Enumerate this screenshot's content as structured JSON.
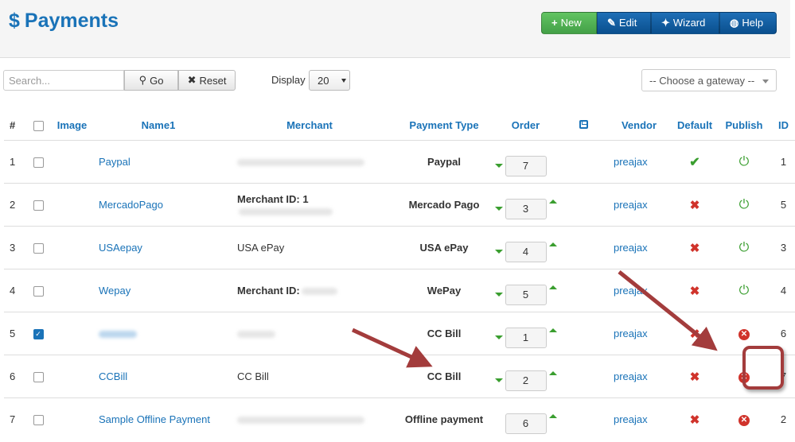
{
  "header": {
    "title": "Payments",
    "toolbar": {
      "new_label": "New",
      "edit_label": "Edit",
      "wizard_label": "Wizard",
      "help_label": "Help"
    }
  },
  "filters": {
    "search_placeholder": "Search...",
    "search_value": "",
    "go_label": "Go",
    "reset_label": "Reset",
    "display_label": "Display",
    "display_value": "20",
    "gateway_value": "-- Choose a gateway --"
  },
  "table": {
    "columns": [
      "#",
      "Image",
      "Name1",
      "Merchant",
      "Payment Type",
      "Order",
      "Vendor",
      "Default",
      "Publish",
      "ID"
    ],
    "rows": [
      {
        "num": "1",
        "name": "Paypal",
        "merchant": "",
        "payment_type": "Paypal",
        "order": "7",
        "vendor": "preajax",
        "id": "1"
      },
      {
        "num": "2",
        "name": "MercadoPago",
        "merchant": "Merchant ID: 1",
        "payment_type": "Mercado Pago",
        "order": "3",
        "vendor": "preajax",
        "id": "5"
      },
      {
        "num": "3",
        "name": "USAepay",
        "merchant": "USA ePay",
        "payment_type": "USA ePay",
        "order": "4",
        "vendor": "preajax",
        "id": "3"
      },
      {
        "num": "4",
        "name": "Wepay",
        "merchant": "Merchant ID:",
        "payment_type": "WePay",
        "order": "5",
        "vendor": "preajax",
        "id": "4"
      },
      {
        "num": "5",
        "name": "",
        "merchant": "",
        "payment_type": "CC Bill",
        "order": "1",
        "vendor": "preajax",
        "id": "6"
      },
      {
        "num": "6",
        "name": "CCBill",
        "merchant": "CC Bill",
        "payment_type": "CC Bill",
        "order": "2",
        "vendor": "preajax",
        "id": "7"
      },
      {
        "num": "7",
        "name": "Sample Offline Payment",
        "merchant": "",
        "payment_type": "Offline payment",
        "order": "6",
        "vendor": "preajax",
        "id": "2"
      }
    ]
  },
  "icons": {
    "title": "dollar-icon",
    "new": "plus-icon",
    "edit": "edit-icon",
    "wizard": "wand-icon",
    "help": "lifebuoy-icon",
    "go": "search-icon",
    "reset": "close-icon",
    "order_save": "save-icon",
    "default_yes": "check-icon",
    "default_no": "x-icon",
    "published": "power-icon",
    "unpublished": "x-circle-icon"
  },
  "colors": {
    "accent": "#1a73b8",
    "new_button": "#4cae4c",
    "toolbar_button": "#0d5a9e",
    "published": "#3a9e2f",
    "unpublished": "#d0332b",
    "annotation": "#a33c3c"
  }
}
